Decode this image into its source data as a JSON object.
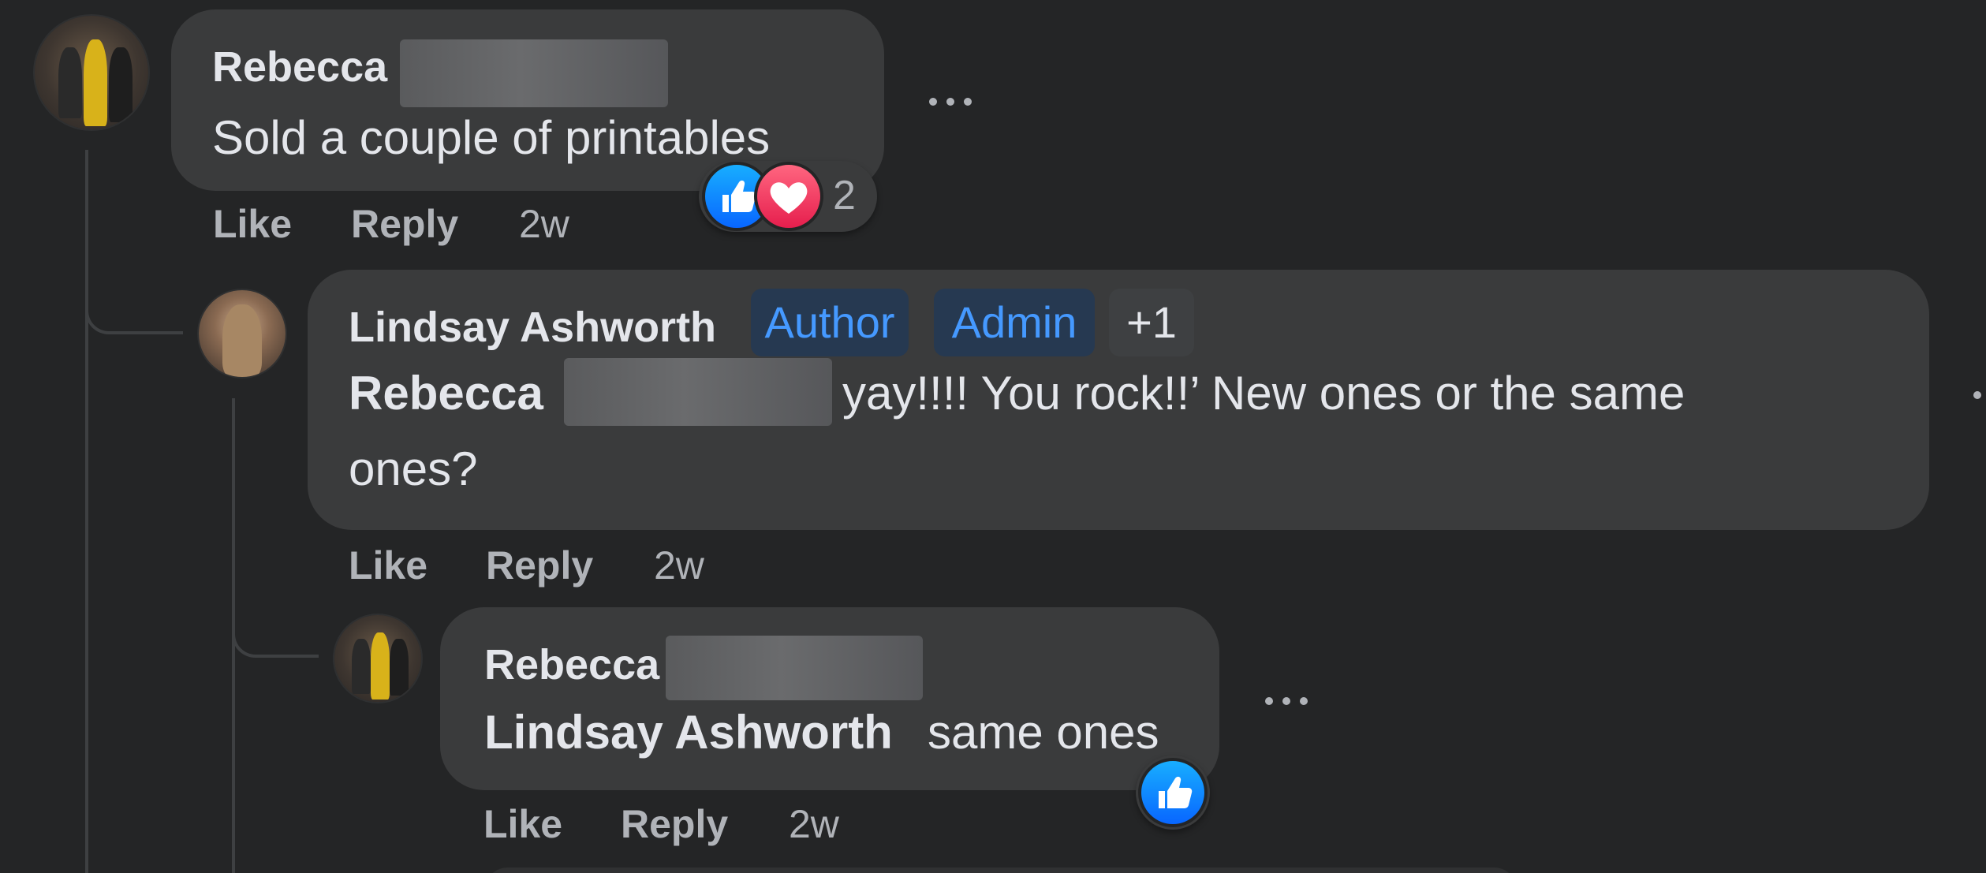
{
  "comments": [
    {
      "author_first": "Rebecca",
      "text": "Sold a couple of printables",
      "actions": {
        "like": "Like",
        "reply": "Reply",
        "time": "2w"
      },
      "reactions": {
        "types": [
          "like-icon",
          "love-icon"
        ],
        "count": "2"
      }
    },
    {
      "author": "Lindsay Ashworth",
      "badges": [
        "Author",
        "Admin",
        "+1"
      ],
      "mention_first": "Rebecca",
      "text_line1": "yay!!!! You rock!!’ New ones or the same",
      "text_line2": "ones?",
      "actions": {
        "like": "Like",
        "reply": "Reply",
        "time": "2w"
      }
    },
    {
      "author_first": "Rebecca",
      "mention": "Lindsay Ashworth",
      "text": "same ones",
      "actions": {
        "like": "Like",
        "reply": "Reply",
        "time": "2w"
      },
      "reactions": {
        "types": [
          "like-icon"
        ]
      }
    }
  ],
  "colors": {
    "background": "#242526",
    "bubble": "#3a3b3c",
    "badge_text": "#4599ff",
    "like_blue": "#0866ff",
    "love_red": "#e61e4d"
  }
}
